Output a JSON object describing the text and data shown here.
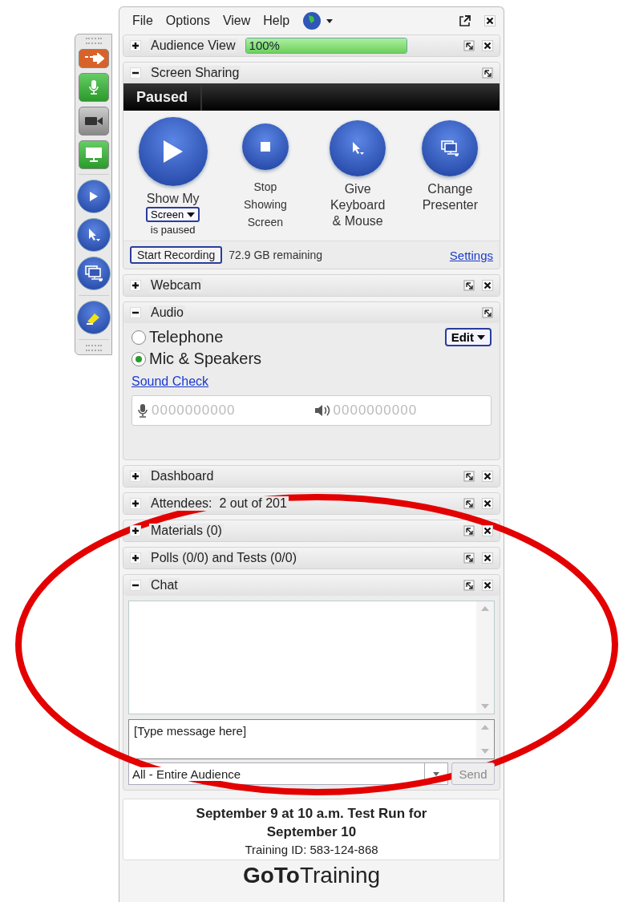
{
  "toolbar": [
    {
      "kind": "arrow"
    },
    {
      "kind": "mic",
      "on": true
    },
    {
      "kind": "camera",
      "on": false
    },
    {
      "kind": "screen",
      "on": true
    },
    {
      "kind": "play"
    },
    {
      "kind": "pointer"
    },
    {
      "kind": "presenter"
    },
    {
      "kind": "marker"
    }
  ],
  "menu": [
    "File",
    "Options",
    "View",
    "Help"
  ],
  "panels": [
    {
      "kind": "meter",
      "title": "Audience View",
      "expanded": false,
      "closable": true,
      "level": 1,
      "reading": "100%"
    },
    {
      "kind": "sharing",
      "title": "Screen Sharing",
      "expanded": true,
      "closable": false,
      "status": "Paused",
      "show": {
        "label": "Show My",
        "dropdown": "Screen",
        "note": "is paused"
      },
      "actions": [
        {
          "kind": "stop",
          "lines": [
            "Stop",
            "Showing",
            "Screen"
          ]
        },
        {
          "kind": "pointer",
          "lines": [
            "Give",
            "Keyboard",
            "& Mouse"
          ]
        },
        {
          "kind": "presenter",
          "lines": [
            "Change",
            "Presenter"
          ]
        }
      ],
      "record_button": "Start Recording",
      "remaining": "72.9 GB remaining",
      "settings_link": "Settings"
    },
    {
      "kind": "plain",
      "title": "Webcam",
      "expanded": false,
      "closable": true
    },
    {
      "kind": "audio",
      "title": "Audio",
      "expanded": true,
      "closable": false,
      "options": [
        {
          "label": "Telephone",
          "selected": false
        },
        {
          "label": "Mic & Speakers",
          "selected": true
        }
      ],
      "edit_button": "Edit",
      "sound_check": "Sound Check",
      "mic_meter": "0000000000",
      "speaker_meter": "0000000000"
    },
    {
      "kind": "plain",
      "title": "Dashboard",
      "expanded": false,
      "closable": true
    },
    {
      "kind": "plain",
      "title": "Attendees:  2 out of 201",
      "expanded": false,
      "closable": true
    },
    {
      "kind": "plain",
      "title": "Materials (0)",
      "expanded": false,
      "closable": true
    },
    {
      "kind": "plain",
      "title": "Polls (0/0) and Tests (0/0)",
      "expanded": false,
      "closable": true
    },
    {
      "kind": "chat",
      "title": "Chat",
      "expanded": true,
      "closable": true,
      "placeholder": "[Type message here]",
      "recipient": "All - Entire Audience",
      "send_button": "Send",
      "send_disabled": true
    }
  ],
  "footer": {
    "title": "September 9 at 10 a.m. Test Run for September 10",
    "training_id": "Training ID: 583-124-868",
    "logo_bold": "GoTo",
    "logo_light": "Training"
  }
}
